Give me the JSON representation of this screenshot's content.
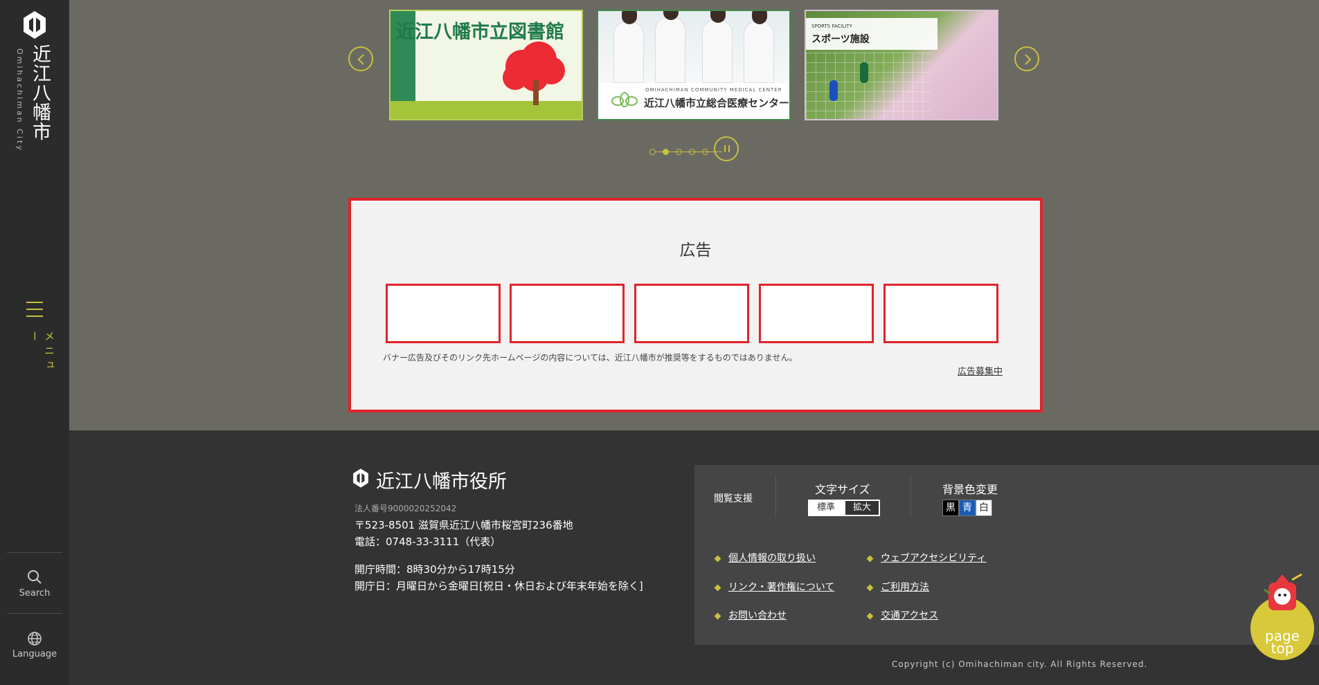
{
  "sidebar": {
    "logo_text": "近江八幡市",
    "logo_en": "Omihachiman City",
    "menu_label": "メニュー",
    "search_label": "Search",
    "language_label": "Language"
  },
  "carousel": {
    "banners": [
      {
        "title": "近江八幡市立図書館"
      },
      {
        "caption_en": "OMIHACHIMAN COMMUNITY MEDICAL CENTER",
        "caption": "近江八幡市立総合医療センター"
      },
      {
        "caption_en": "SPORTS FACILITY",
        "caption": "スポーツ施設"
      }
    ],
    "active_dot": 1
  },
  "ad": {
    "title": "広告",
    "note": "バナー広告及びそのリンク先ホームページの内容については、近江八幡市が推奨等をするものではありません。",
    "recruit": "広告募集中"
  },
  "footer": {
    "office_name": "近江八幡市役所",
    "corp_no": "法人番号9000020252042",
    "address": "〒523-8501 滋賀県近江八幡市桜宮町236番地",
    "phone": "電話：0748-33-3111（代表）",
    "hours": "開庁時間：8時30分から17時15分",
    "days": "開庁日：月曜日から金曜日[祝日・休日および年末年始を除く]",
    "copyright": "Copyright (c) Omihachiman city. All Rights Reserved."
  },
  "accessibility": {
    "assist_label": "閲覧支援",
    "size_label": "文字サイズ",
    "size_standard": "標準",
    "size_large": "拡大",
    "bg_label": "背景色変更",
    "bg_black": "黒",
    "bg_blue": "青",
    "bg_white": "白"
  },
  "links": {
    "privacy": "個人情報の取り扱い",
    "web_accessibility": "ウェブアクセシビリティ",
    "copyright_links": "リンク・著作権について",
    "usage": "ご利用方法",
    "contact": "お問い合わせ",
    "access": "交通アクセス"
  },
  "pagetop": {
    "line1": "page",
    "line2": "top"
  },
  "colors": {
    "accent": "#c9c040",
    "ad_border": "#e0232b",
    "sidebar": "#2b2b2b",
    "main": "#6b6a62"
  }
}
